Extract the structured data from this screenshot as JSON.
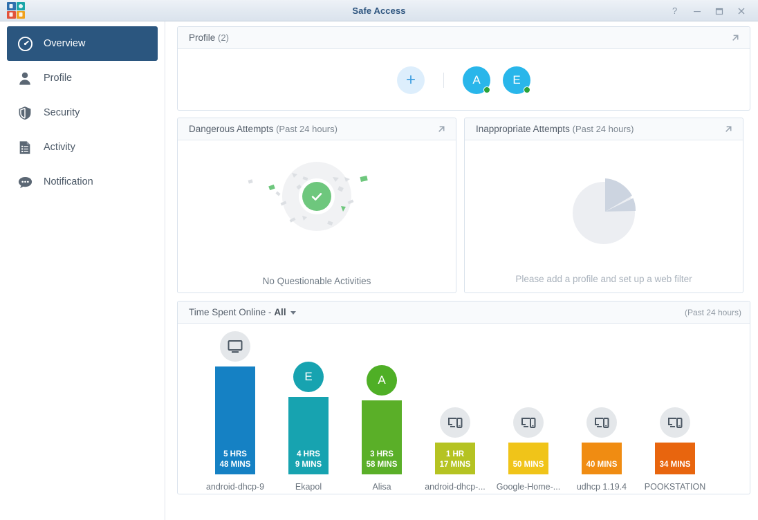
{
  "window": {
    "title": "Safe Access",
    "app_icon": "safe-access-icon",
    "controls": [
      {
        "name": "help-button",
        "glyph": "?"
      },
      {
        "name": "minimize-button",
        "glyph": "–"
      },
      {
        "name": "maximize-button",
        "glyph": "□"
      },
      {
        "name": "close-button",
        "glyph": "✕"
      }
    ]
  },
  "sidebar": {
    "items": [
      {
        "label": "Overview",
        "icon": "gauge-icon",
        "active": true
      },
      {
        "label": "Profile",
        "icon": "person-icon",
        "active": false
      },
      {
        "label": "Security",
        "icon": "shield-icon",
        "active": false
      },
      {
        "label": "Activity",
        "icon": "document-list-icon",
        "active": false
      },
      {
        "label": "Notification",
        "icon": "chat-bubble-icon",
        "active": false
      }
    ],
    "active_color": "#2b567f"
  },
  "profile_panel": {
    "title": "Profile",
    "count": "(2)",
    "add_button_label": "+",
    "expand_icon": "expand-arrow-icon",
    "avatars": [
      {
        "initial": "A",
        "color": "#29b6ea",
        "status": "online"
      },
      {
        "initial": "E",
        "color": "#29b6ea",
        "status": "online"
      }
    ]
  },
  "dangerous_panel": {
    "title": "Dangerous Attempts",
    "period": "(Past 24 hours)",
    "empty_text": "No Questionable Activities",
    "status_icon": "check-circle-icon",
    "accent": "#6ec77d"
  },
  "inappropriate_panel": {
    "title": "Inappropriate Attempts",
    "period": "(Past 24 hours)",
    "empty_text": "Please add a profile and set up a web filter",
    "placeholder_icon": "pie-chart-icon"
  },
  "time_panel": {
    "title_prefix": "Time Spent Online - ",
    "filter_value": "All",
    "period": "(Past 24 hours)"
  },
  "chart_data": {
    "type": "bar",
    "title": "Time Spent Online - All",
    "subtitle": "(Past 24 hours)",
    "xlabel": "",
    "ylabel": "Time spent online",
    "ylim": [
      0,
      348
    ],
    "grid": false,
    "legend": false,
    "categories": [
      "android-dhcp-9",
      "Ekapol",
      "Alisa",
      "android-dhcp-...",
      "Google-Home-...",
      "udhcp 1.19.4",
      "POOKSTATION"
    ],
    "values": [
      348,
      249,
      238,
      77,
      50,
      40,
      34
    ],
    "value_labels": [
      "5 HRS\n48 MINS",
      "4 HRS\n9 MINS",
      "3 HRS\n58 MINS",
      "1 HR\n17 MINS",
      "50 MINS",
      "40 MINS",
      "34 MINS"
    ],
    "colors": [
      "#1581c4",
      "#17a3b0",
      "#5aaf28",
      "#b5c322",
      "#f0c419",
      "#f08c12",
      "#e8650e"
    ],
    "bars": [
      {
        "label": "android-dhcp-9",
        "value_label_line1": "5 HRS",
        "value_label_line2": "48 MINS",
        "minutes": 348,
        "color": "#1581c4",
        "badge": {
          "type": "device",
          "icon": "monitor-icon"
        }
      },
      {
        "label": "Ekapol",
        "value_label_line1": "4 HRS",
        "value_label_line2": "9 MINS",
        "minutes": 249,
        "color": "#17a3b0",
        "badge": {
          "type": "initial",
          "text": "E",
          "color": "#17a3b0"
        }
      },
      {
        "label": "Alisa",
        "value_label_line1": "3 HRS",
        "value_label_line2": "58 MINS",
        "minutes": 238,
        "color": "#5aaf28",
        "badge": {
          "type": "initial",
          "text": "A",
          "color": "#4faf26"
        }
      },
      {
        "label": "android-dhcp-...",
        "value_label_line1": "1 HR",
        "value_label_line2": "17 MINS",
        "minutes": 77,
        "color": "#b5c322",
        "badge": {
          "type": "device",
          "icon": "devices-icon"
        }
      },
      {
        "label": "Google-Home-...",
        "value_label_line1": "50 MINS",
        "value_label_line2": "",
        "minutes": 50,
        "color": "#f0c419",
        "badge": {
          "type": "device",
          "icon": "devices-icon"
        }
      },
      {
        "label": "udhcp 1.19.4",
        "value_label_line1": "40 MINS",
        "value_label_line2": "",
        "minutes": 40,
        "color": "#f08c12",
        "badge": {
          "type": "device",
          "icon": "devices-icon"
        }
      },
      {
        "label": "POOKSTATION",
        "value_label_line1": "34 MINS",
        "value_label_line2": "",
        "minutes": 34,
        "color": "#e8650e",
        "badge": {
          "type": "device",
          "icon": "devices-icon"
        }
      }
    ]
  }
}
